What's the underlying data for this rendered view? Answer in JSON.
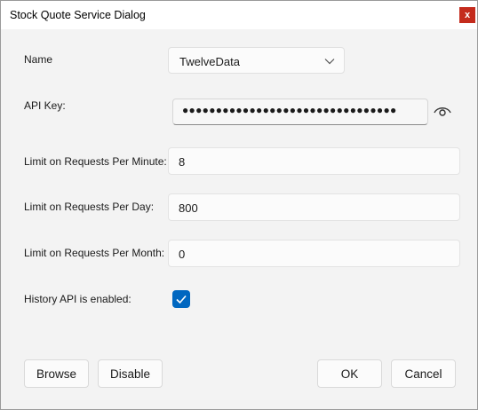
{
  "window": {
    "title": "Stock Quote Service Dialog",
    "close_label": "x"
  },
  "form": {
    "name_label": "Name",
    "name_value": "TwelveData",
    "api_key_label": "API Key:",
    "api_key_masked": "●●●●●●●●●●●●●●●●●●●●●●●●●●●●●●●●",
    "per_minute_label": "Limit on Requests Per Minute:",
    "per_minute_value": "8",
    "per_day_label": "Limit on Requests Per Day:",
    "per_day_value": "800",
    "per_month_label": "Limit on Requests Per Month:",
    "per_month_value": "0",
    "history_label": "History API is enabled:",
    "history_enabled": true
  },
  "buttons": {
    "browse": "Browse",
    "disable": "Disable",
    "ok": "OK",
    "cancel": "Cancel"
  },
  "colors": {
    "accent": "#0067c0",
    "close": "#c42b1c"
  },
  "icons": {
    "combo": "chevron-down-icon",
    "reveal": "eye-icon",
    "check": "checkmark-icon"
  }
}
